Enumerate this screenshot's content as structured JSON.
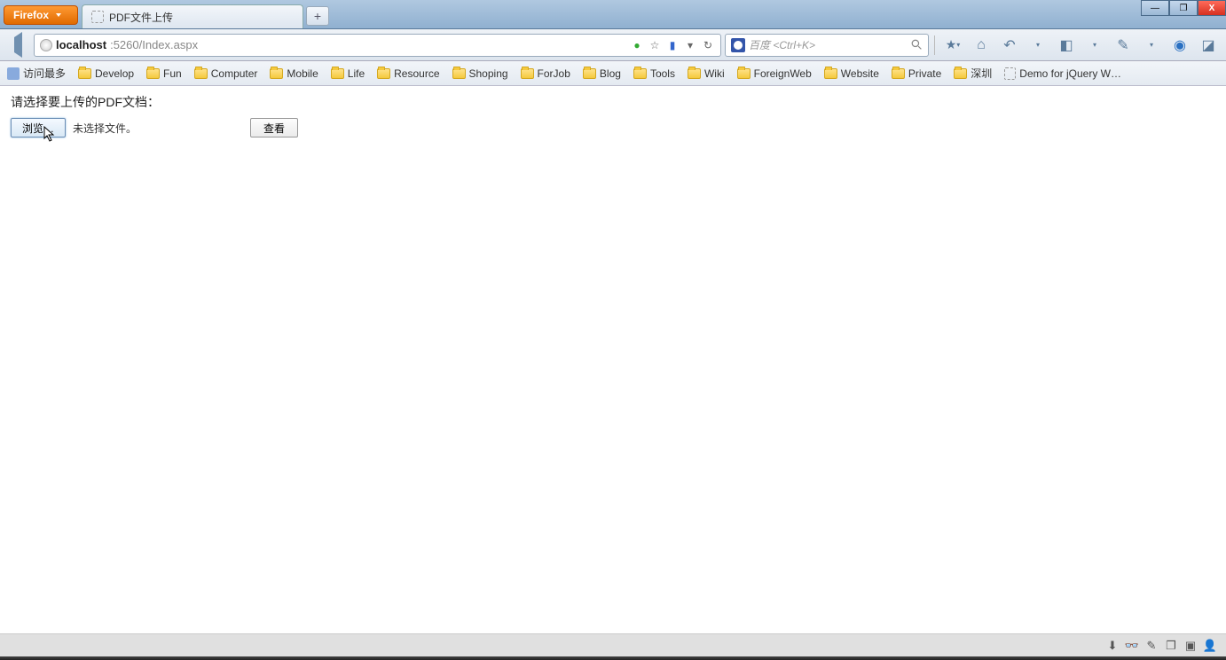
{
  "browser": {
    "label": "Firefox"
  },
  "tab": {
    "title": "PDF文件上传"
  },
  "newtab": {
    "glyph": "+"
  },
  "window": {
    "min": "—",
    "max": "❐",
    "close": "X"
  },
  "url": {
    "host": "localhost",
    "rest": ":5260/Index.aspx"
  },
  "navicons": {
    "share": "●",
    "star": "☆",
    "device": "▮",
    "refresh": "↻"
  },
  "search": {
    "placeholder": "百度 <Ctrl+K>"
  },
  "toolbar": {
    "bookmark": "▾",
    "home": "⌂",
    "undo": "↶",
    "window": "◧",
    "palette": "✎",
    "globe": "◉",
    "app": "◪"
  },
  "bookmarks": [
    {
      "icon": "most",
      "label": "访问最多"
    },
    {
      "icon": "folder",
      "label": "Develop"
    },
    {
      "icon": "folder",
      "label": "Fun"
    },
    {
      "icon": "folder",
      "label": "Computer"
    },
    {
      "icon": "folder",
      "label": "Mobile"
    },
    {
      "icon": "folder",
      "label": "Life"
    },
    {
      "icon": "folder",
      "label": "Resource"
    },
    {
      "icon": "folder",
      "label": "Shoping"
    },
    {
      "icon": "folder",
      "label": "ForJob"
    },
    {
      "icon": "folder",
      "label": "Blog"
    },
    {
      "icon": "folder",
      "label": "Tools"
    },
    {
      "icon": "folder",
      "label": "Wiki"
    },
    {
      "icon": "folder",
      "label": "ForeignWeb"
    },
    {
      "icon": "folder",
      "label": "Website"
    },
    {
      "icon": "folder",
      "label": "Private"
    },
    {
      "icon": "folder",
      "label": "深圳"
    },
    {
      "icon": "page",
      "label": "Demo for jQuery W…"
    }
  ],
  "content": {
    "prompt": "请选择要上传的PDF文档：",
    "browse_button": "浏览…",
    "file_status": "未选择文件。",
    "view_button": "查看"
  },
  "status_icons": [
    "⬇",
    "👓",
    "✎",
    "❐",
    "▣",
    "👤"
  ]
}
